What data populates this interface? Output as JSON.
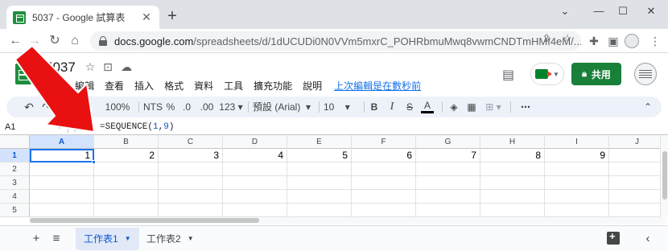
{
  "browser": {
    "tab_title": "5037 - Google 試算表",
    "tab_close": "✕",
    "new_tab": "+",
    "window_controls": [
      "⌄",
      "—",
      "☐",
      "✕"
    ],
    "url_host": "docs.google.com",
    "url_path": "/spreadsheets/d/1dUCUDi0N0VVm5mxrC_POHRbmuMwq8vwmCNDTmHMf4eM/..."
  },
  "sheets": {
    "doc_title": "5037",
    "menu": [
      "檔案",
      "編輯",
      "查看",
      "插入",
      "格式",
      "資料",
      "工具",
      "擴充功能",
      "說明"
    ],
    "last_edit": "上次編輯是在數秒前",
    "share_label": "共用"
  },
  "toolbar": {
    "zoom": "100%",
    "currency": "NTS",
    "percent": "%",
    "decrease_decimal": ".0",
    "increase_decimal": ".00",
    "more_formats": "123",
    "font_family": "預設 (Arial)",
    "font_size": "10",
    "bold": "B",
    "italic": "I",
    "strikethrough": "S",
    "text_color": "A",
    "more": "⋯"
  },
  "formula_bar": {
    "name_box": "A1",
    "fx": "fx",
    "formula_prefix": "=SEQUENCE(",
    "formula_arg1": "1",
    "formula_comma": ",",
    "formula_arg2": "9",
    "formula_suffix": ")"
  },
  "grid": {
    "columns": [
      "A",
      "B",
      "C",
      "D",
      "E",
      "F",
      "G",
      "H",
      "I",
      "J"
    ],
    "rows": [
      "1",
      "2",
      "3",
      "4",
      "5"
    ],
    "row1_values": [
      "1",
      "2",
      "3",
      "4",
      "5",
      "6",
      "7",
      "8",
      "9"
    ],
    "active_cell": "A1"
  },
  "sheet_tabs": {
    "tabs": [
      "工作表1",
      "工作表2"
    ],
    "active": "工作表1"
  },
  "colors": {
    "accent": "#1a73e8",
    "sheets_green": "#188038",
    "annotation_red": "#e81010"
  }
}
